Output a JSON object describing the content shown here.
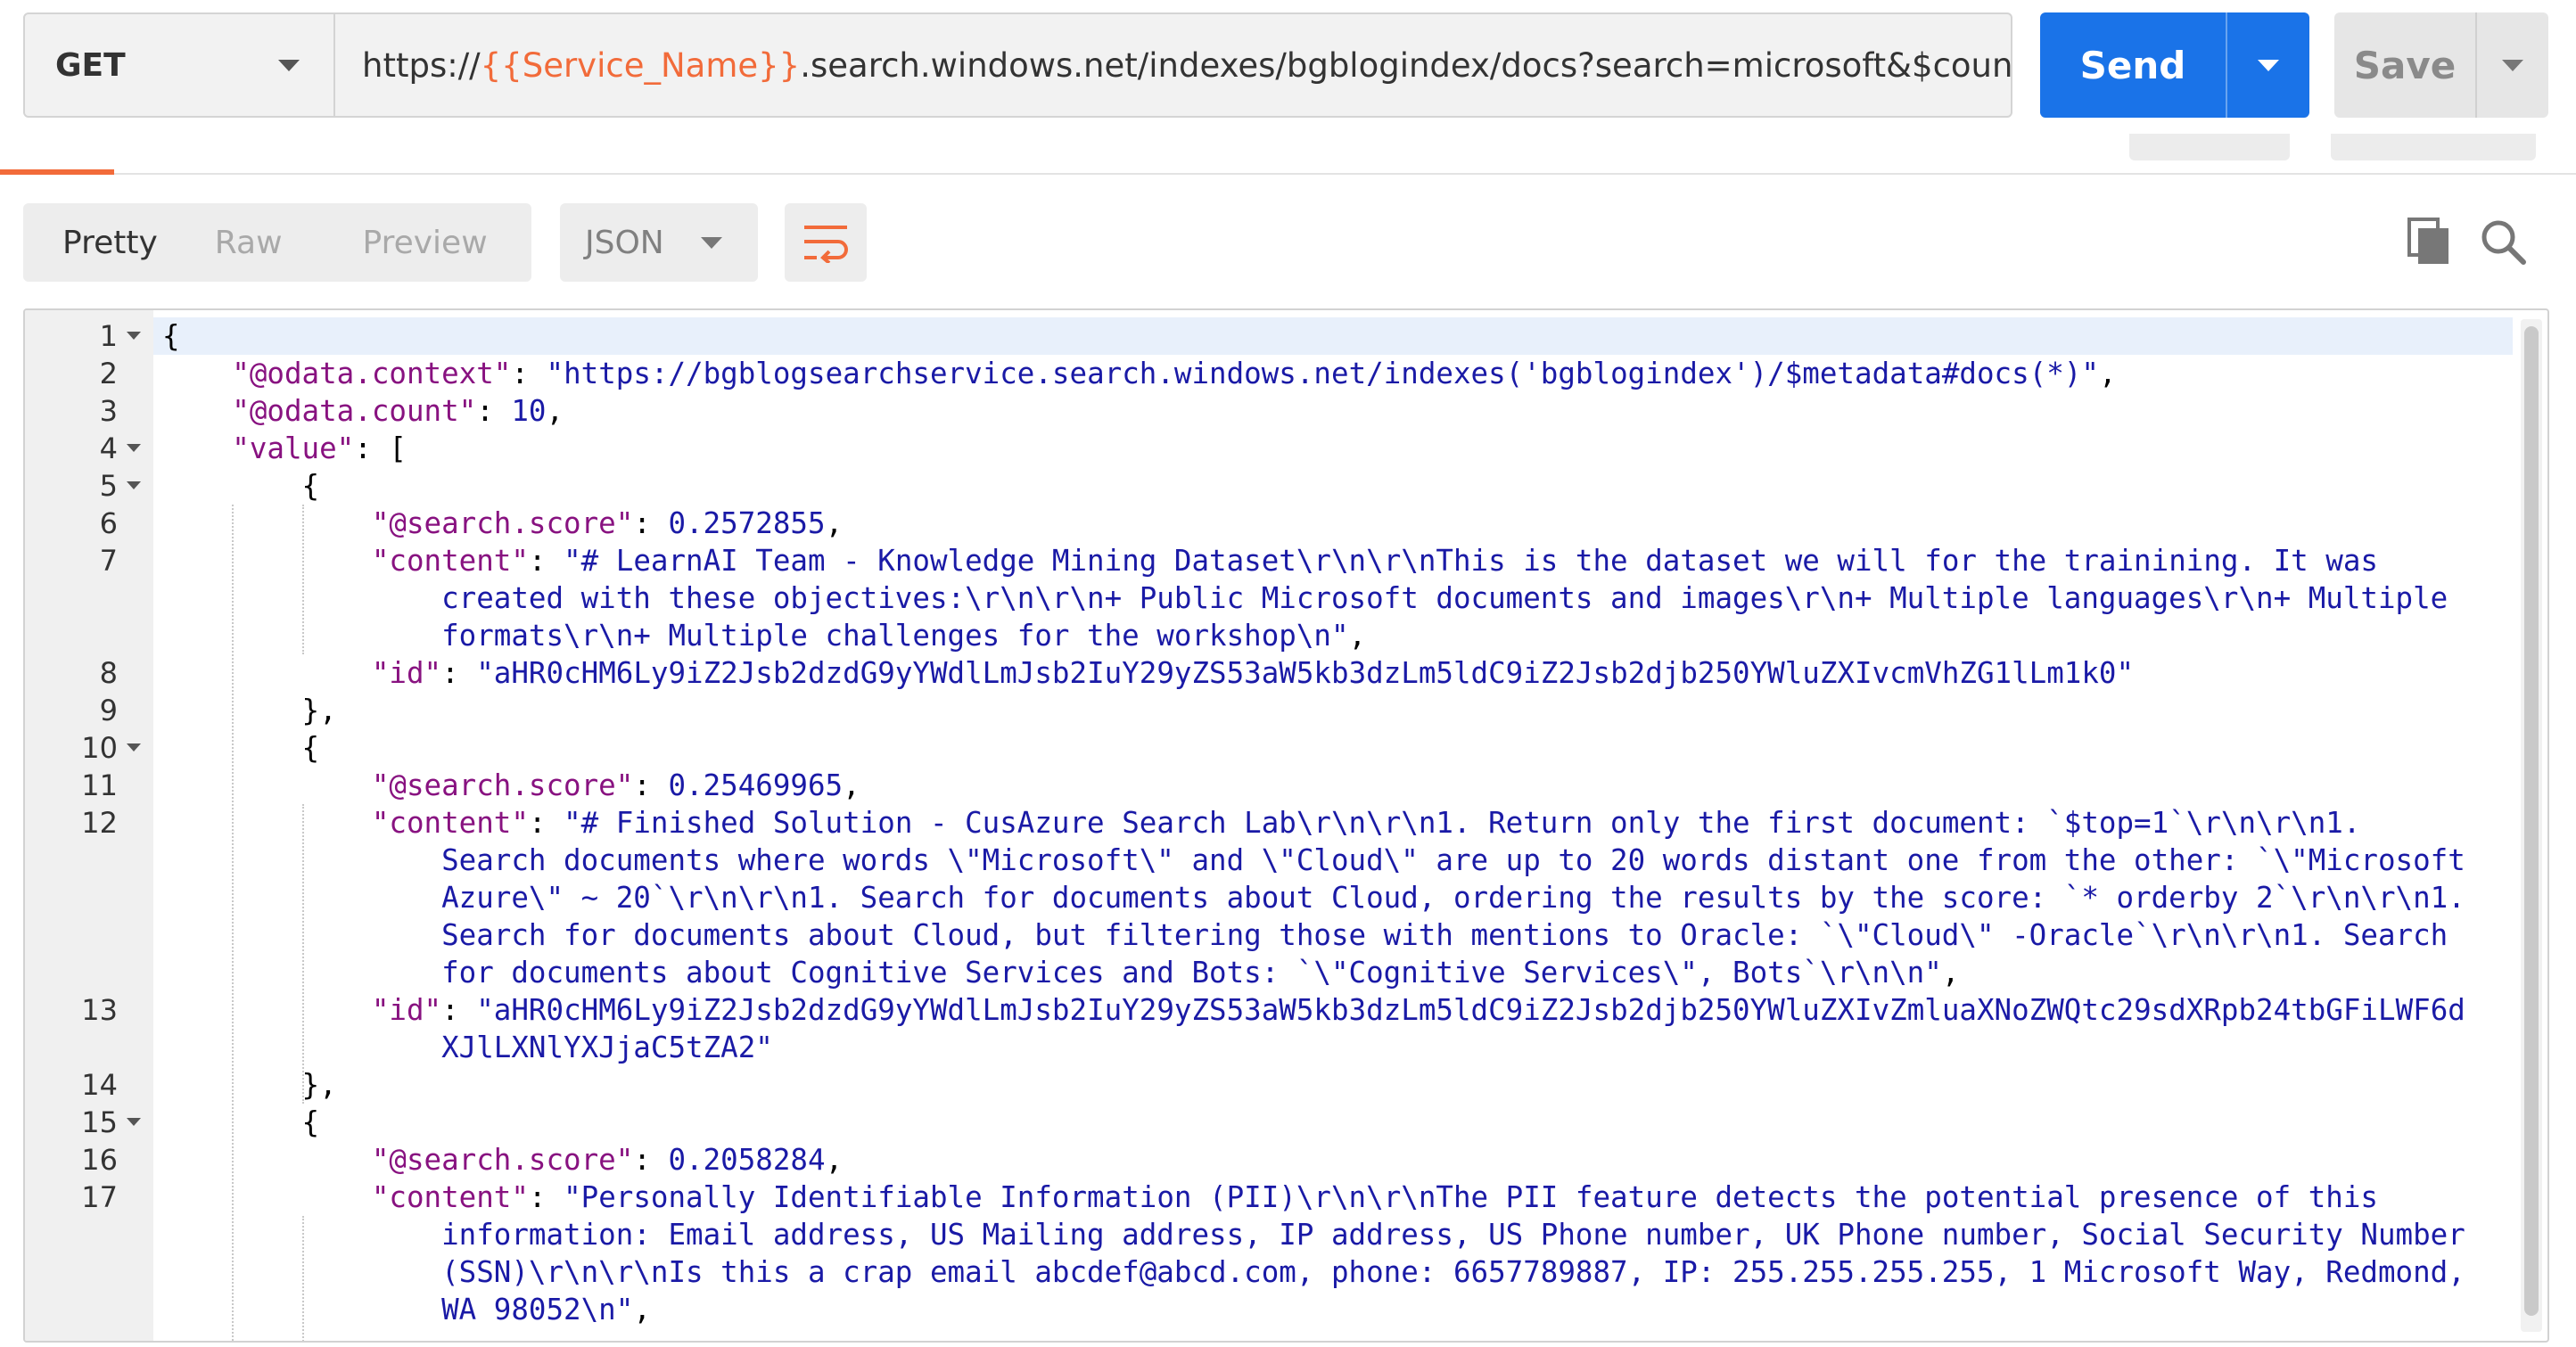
{
  "request": {
    "method": "GET",
    "url_prefix": "https://",
    "url_variable": "{{Service_Name}}",
    "url_suffix": ".search.windows.net/indexes/bgblogindex/docs?search=microsoft&$count=true&...",
    "send_label": "Send",
    "save_label": "Save"
  },
  "response_toolbar": {
    "view_tabs": [
      "Pretty",
      "Raw",
      "Preview"
    ],
    "active_view": "Pretty",
    "format": "JSON",
    "icons": [
      "wrap-lines-icon",
      "copy-icon",
      "search-icon"
    ]
  },
  "colors": {
    "accent_orange": "#f26b3a",
    "send_blue": "#1a73e8",
    "json_key": "#881280",
    "json_value": "#1a1aa6"
  },
  "code": {
    "lines": [
      {
        "no": "1",
        "fold": true,
        "segs": [
          [
            "p",
            "{"
          ]
        ]
      },
      {
        "no": "2",
        "segs": [
          [
            "p",
            "    "
          ],
          [
            "k",
            "\"@odata.context\""
          ],
          [
            "p",
            ": "
          ],
          [
            "s",
            "\"https://bgblogsearchservice.search.windows.net/indexes('bgblogindex')/$metadata#docs(*)\""
          ],
          [
            "p",
            ","
          ]
        ]
      },
      {
        "no": "3",
        "segs": [
          [
            "p",
            "    "
          ],
          [
            "k",
            "\"@odata.count\""
          ],
          [
            "p",
            ": "
          ],
          [
            "n",
            "10"
          ],
          [
            "p",
            ","
          ]
        ]
      },
      {
        "no": "4",
        "fold": true,
        "segs": [
          [
            "p",
            "    "
          ],
          [
            "k",
            "\"value\""
          ],
          [
            "p",
            ": ["
          ]
        ]
      },
      {
        "no": "5",
        "fold": true,
        "segs": [
          [
            "p",
            "        {"
          ]
        ]
      },
      {
        "no": "6",
        "segs": [
          [
            "p",
            "            "
          ],
          [
            "k",
            "\"@search.score\""
          ],
          [
            "p",
            ": "
          ],
          [
            "n",
            "0.2572855"
          ],
          [
            "p",
            ","
          ]
        ]
      },
      {
        "no": "7",
        "segs": [
          [
            "p",
            "            "
          ],
          [
            "k",
            "\"content\""
          ],
          [
            "p",
            ": "
          ],
          [
            "s",
            "\"# LearnAI Team - Knowledge Mining Dataset\\r\\n\\r\\nThis is the dataset we will for the trainining. It was"
          ]
        ]
      },
      {
        "no": "",
        "segs": [
          [
            "p",
            "                "
          ],
          [
            "s",
            "created with these objectives:\\r\\n\\r\\n+ Public Microsoft documents and images\\r\\n+ Multiple languages\\r\\n+ Multiple"
          ]
        ]
      },
      {
        "no": "",
        "segs": [
          [
            "p",
            "                "
          ],
          [
            "s",
            "formats\\r\\n+ Multiple challenges for the workshop\\n\""
          ],
          [
            "p",
            ","
          ]
        ]
      },
      {
        "no": "8",
        "segs": [
          [
            "p",
            "            "
          ],
          [
            "k",
            "\"id\""
          ],
          [
            "p",
            ": "
          ],
          [
            "s",
            "\"aHR0cHM6Ly9iZ2Jsb2dzdG9yYWdlLmJsb2IuY29yZS53aW5kb3dzLm5ldC9iZ2Jsb2djb250YWluZXIvcmVhZG1lLm1k0\""
          ]
        ]
      },
      {
        "no": "9",
        "segs": [
          [
            "p",
            "        },"
          ]
        ]
      },
      {
        "no": "10",
        "fold": true,
        "segs": [
          [
            "p",
            "        {"
          ]
        ]
      },
      {
        "no": "11",
        "segs": [
          [
            "p",
            "            "
          ],
          [
            "k",
            "\"@search.score\""
          ],
          [
            "p",
            ": "
          ],
          [
            "n",
            "0.25469965"
          ],
          [
            "p",
            ","
          ]
        ]
      },
      {
        "no": "12",
        "segs": [
          [
            "p",
            "            "
          ],
          [
            "k",
            "\"content\""
          ],
          [
            "p",
            ": "
          ],
          [
            "s",
            "\"# Finished Solution - CusAzure Search Lab\\r\\n\\r\\n1. Return only the first document: `$top=1`\\r\\n\\r\\n1."
          ]
        ]
      },
      {
        "no": "",
        "segs": [
          [
            "p",
            "                "
          ],
          [
            "s",
            "Search documents where words \\\"Microsoft\\\" and \\\"Cloud\\\" are up to 20 words distant one from the other: `\\\"Microsoft"
          ]
        ]
      },
      {
        "no": "",
        "segs": [
          [
            "p",
            "                "
          ],
          [
            "s",
            "Azure\\\" ~ 20`\\r\\n\\r\\n1. Search for documents about Cloud, ordering the results by the score: `* orderby 2`\\r\\n\\r\\n1."
          ]
        ]
      },
      {
        "no": "",
        "segs": [
          [
            "p",
            "                "
          ],
          [
            "s",
            "Search for documents about Cloud, but filtering those with mentions to Oracle: `\\\"Cloud\\\" -Oracle`\\r\\n\\r\\n1. Search"
          ]
        ]
      },
      {
        "no": "",
        "segs": [
          [
            "p",
            "                "
          ],
          [
            "s",
            "for documents about Cognitive Services and Bots: `\\\"Cognitive Services\\\", Bots`\\r\\n\\n\""
          ],
          [
            "p",
            ","
          ]
        ]
      },
      {
        "no": "13",
        "segs": [
          [
            "p",
            "            "
          ],
          [
            "k",
            "\"id\""
          ],
          [
            "p",
            ": "
          ],
          [
            "s",
            "\"aHR0cHM6Ly9iZ2Jsb2dzdG9yYWdlLmJsb2IuY29yZS53aW5kb3dzLm5ldC9iZ2Jsb2djb250YWluZXIvZmluaXNoZWQtc29sdXRpb24tbGFiLWF6d"
          ]
        ]
      },
      {
        "no": "",
        "segs": [
          [
            "p",
            "                "
          ],
          [
            "s",
            "XJlLXNlYXJjaC5tZA2\""
          ]
        ]
      },
      {
        "no": "14",
        "segs": [
          [
            "p",
            "        },"
          ]
        ]
      },
      {
        "no": "15",
        "fold": true,
        "segs": [
          [
            "p",
            "        {"
          ]
        ]
      },
      {
        "no": "16",
        "segs": [
          [
            "p",
            "            "
          ],
          [
            "k",
            "\"@search.score\""
          ],
          [
            "p",
            ": "
          ],
          [
            "n",
            "0.2058284"
          ],
          [
            "p",
            ","
          ]
        ]
      },
      {
        "no": "17",
        "segs": [
          [
            "p",
            "            "
          ],
          [
            "k",
            "\"content\""
          ],
          [
            "p",
            ": "
          ],
          [
            "s",
            "\"Personally Identifiable Information (PII)\\r\\n\\r\\nThe PII feature detects the potential presence of this"
          ]
        ]
      },
      {
        "no": "",
        "segs": [
          [
            "p",
            "                "
          ],
          [
            "s",
            "information: Email address, US Mailing address, IP address, US Phone number, UK Phone number, Social Security Number"
          ]
        ]
      },
      {
        "no": "",
        "segs": [
          [
            "p",
            "                "
          ],
          [
            "s",
            "(SSN)\\r\\n\\r\\nIs this a crap email abcdef@abcd.com, phone: 6657789887, IP: 255.255.255.255, 1 Microsoft Way, Redmond,"
          ]
        ]
      },
      {
        "no": "",
        "segs": [
          [
            "p",
            "                "
          ],
          [
            "s",
            "WA 98052\\n\""
          ],
          [
            "p",
            ","
          ]
        ]
      }
    ]
  }
}
